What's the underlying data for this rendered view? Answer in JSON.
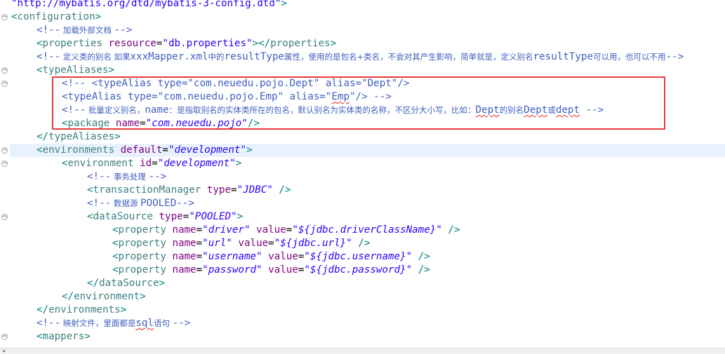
{
  "editor": {
    "lines": [
      {
        "gutter": "",
        "fold": "",
        "highlight": false,
        "indent": 0,
        "tokens": [
          [
            "val",
            "\"http://mybatis.org/dtd/mybatis-3-config.dtd\""
          ],
          [
            "punc",
            ">"
          ]
        ]
      },
      {
        "gutter": "",
        "fold": "collapse",
        "highlight": false,
        "indent": 0,
        "tokens": [
          [
            "punc",
            "<"
          ],
          [
            "tag",
            "configuration"
          ],
          [
            "punc",
            ">"
          ]
        ]
      },
      {
        "gutter": "",
        "fold": "",
        "highlight": false,
        "indent": 1,
        "tokens": [
          [
            "com",
            "<!--"
          ],
          [
            "comcjk",
            " 加载外部文档 "
          ],
          [
            "com",
            "-->"
          ]
        ]
      },
      {
        "gutter": "",
        "fold": "",
        "highlight": false,
        "indent": 1,
        "tokens": [
          [
            "punc",
            "<"
          ],
          [
            "tag",
            "properties"
          ],
          [
            "plain",
            " "
          ],
          [
            "attr",
            "resource"
          ],
          [
            "plain",
            "="
          ],
          [
            "val",
            "\"db.properties\""
          ],
          [
            "punc",
            "></"
          ],
          [
            "tag",
            "properties"
          ],
          [
            "punc",
            ">"
          ]
        ]
      },
      {
        "gutter": "",
        "fold": "",
        "highlight": false,
        "indent": 1,
        "tokens": [
          [
            "com",
            "<!--"
          ],
          [
            "comcjk",
            " 定义类的别名 如果"
          ],
          [
            "com",
            "xxxMapper.xml"
          ],
          [
            "comcjk",
            "中的"
          ],
          [
            "com",
            "resultType"
          ],
          [
            "comcjk",
            "属性，使用的是包名+类名，不会对其产生影响，简单就是，定义别名"
          ],
          [
            "com",
            "resultType"
          ],
          [
            "comcjk",
            "可以用，也可以不用"
          ],
          [
            "com",
            "-->"
          ]
        ]
      },
      {
        "gutter": "",
        "fold": "collapse",
        "highlight": false,
        "indent": 1,
        "tokens": [
          [
            "punc",
            "<"
          ],
          [
            "tag",
            "typeAliases"
          ],
          [
            "punc",
            ">"
          ]
        ]
      },
      {
        "gutter": "",
        "fold": "collapse",
        "highlight": false,
        "indent": 2,
        "tokens": [
          [
            "com",
            "<!-- <typeAlias type=\"com.neuedu.pojo.Dept\" alias=\"Dept\"/>"
          ]
        ]
      },
      {
        "gutter": "",
        "fold": "",
        "highlight": false,
        "indent": 2,
        "tokens": [
          [
            "com",
            "<typeAlias type=\"com.neuedu.pojo.Emp\" alias=\""
          ],
          [
            "comsq",
            "Emp"
          ],
          [
            "com",
            "\"/> -->"
          ]
        ]
      },
      {
        "gutter": "",
        "fold": "",
        "highlight": false,
        "indent": 2,
        "tokens": [
          [
            "com",
            "<!--"
          ],
          [
            "comcjk",
            " 批量定义别名，"
          ],
          [
            "com",
            "name"
          ],
          [
            "comcjk",
            "：是指取别名的实体类所在的包名，默认别名为实体类的名称，不区分大小写，比如："
          ],
          [
            "comsq",
            "Dept"
          ],
          [
            "comcjk",
            "的别名"
          ],
          [
            "comsq",
            "Dept"
          ],
          [
            "comcjk",
            "或"
          ],
          [
            "comsq",
            "dept"
          ],
          [
            "com",
            " -->"
          ]
        ]
      },
      {
        "gutter": "",
        "fold": "",
        "highlight": false,
        "indent": 2,
        "tokens": [
          [
            "punc",
            "<"
          ],
          [
            "tag",
            "package"
          ],
          [
            "plain",
            " "
          ],
          [
            "attr",
            "name"
          ],
          [
            "plain",
            "="
          ],
          [
            "ival",
            "\"com.neuedu.pojo\""
          ],
          [
            "punc",
            "/>"
          ]
        ]
      },
      {
        "gutter": "",
        "fold": "",
        "highlight": false,
        "indent": 1,
        "tokens": [
          [
            "punc",
            "</"
          ],
          [
            "tag",
            "typeAliases"
          ],
          [
            "punc",
            ">"
          ]
        ]
      },
      {
        "gutter": "",
        "fold": "collapse",
        "highlight": true,
        "indent": 1,
        "tokens": [
          [
            "punc",
            "<"
          ],
          [
            "tag",
            "environments"
          ],
          [
            "plain",
            " "
          ],
          [
            "attr",
            "default"
          ],
          [
            "plain",
            "="
          ],
          [
            "ival",
            "\"development\""
          ],
          [
            "punc",
            ">"
          ]
        ]
      },
      {
        "gutter": "",
        "fold": "collapse",
        "highlight": false,
        "indent": 2,
        "tokens": [
          [
            "punc",
            "<"
          ],
          [
            "tag",
            "environment"
          ],
          [
            "plain",
            " "
          ],
          [
            "attr",
            "id"
          ],
          [
            "plain",
            "="
          ],
          [
            "ival",
            "\"development\""
          ],
          [
            "punc",
            ">"
          ]
        ]
      },
      {
        "gutter": "",
        "fold": "",
        "highlight": false,
        "indent": 3,
        "tokens": [
          [
            "com",
            "<!--"
          ],
          [
            "comcjk",
            " 事务处理 "
          ],
          [
            "com",
            "-->"
          ]
        ]
      },
      {
        "gutter": "",
        "fold": "",
        "highlight": false,
        "indent": 3,
        "tokens": [
          [
            "punc",
            "<"
          ],
          [
            "tag",
            "transactionManager"
          ],
          [
            "plain",
            " "
          ],
          [
            "attr",
            "type"
          ],
          [
            "plain",
            "="
          ],
          [
            "ival",
            "\"JDBC\""
          ],
          [
            "plain",
            " "
          ],
          [
            "punc",
            "/>"
          ]
        ]
      },
      {
        "gutter": "",
        "fold": "",
        "highlight": false,
        "indent": 3,
        "tokens": [
          [
            "com",
            "<!--"
          ],
          [
            "comcjk",
            " 数据源 "
          ],
          [
            "com",
            "POOLED-->"
          ]
        ]
      },
      {
        "gutter": "",
        "fold": "collapse",
        "highlight": false,
        "indent": 3,
        "tokens": [
          [
            "punc",
            "<"
          ],
          [
            "tag",
            "dataSource"
          ],
          [
            "plain",
            " "
          ],
          [
            "attr",
            "type"
          ],
          [
            "plain",
            "="
          ],
          [
            "ival",
            "\"POOLED\""
          ],
          [
            "punc",
            ">"
          ]
        ]
      },
      {
        "gutter": "",
        "fold": "",
        "highlight": false,
        "indent": 4,
        "tokens": [
          [
            "punc",
            "<"
          ],
          [
            "tag",
            "property"
          ],
          [
            "plain",
            " "
          ],
          [
            "attr",
            "name"
          ],
          [
            "plain",
            "="
          ],
          [
            "ival",
            "\"driver\""
          ],
          [
            "plain",
            " "
          ],
          [
            "attr",
            "value"
          ],
          [
            "plain",
            "="
          ],
          [
            "ival",
            "\"${jdbc.driverClassName}\""
          ],
          [
            "plain",
            " "
          ],
          [
            "punc",
            "/>"
          ]
        ]
      },
      {
        "gutter": "",
        "fold": "",
        "highlight": false,
        "indent": 4,
        "tokens": [
          [
            "punc",
            "<"
          ],
          [
            "tag",
            "property"
          ],
          [
            "plain",
            " "
          ],
          [
            "attr",
            "name"
          ],
          [
            "plain",
            "="
          ],
          [
            "ival",
            "\"url\""
          ],
          [
            "plain",
            " "
          ],
          [
            "attr",
            "value"
          ],
          [
            "plain",
            "="
          ],
          [
            "ival",
            "\"${jdbc.url}\""
          ],
          [
            "plain",
            " "
          ],
          [
            "punc",
            "/>"
          ]
        ]
      },
      {
        "gutter": "",
        "fold": "",
        "highlight": false,
        "indent": 4,
        "tokens": [
          [
            "punc",
            "<"
          ],
          [
            "tag",
            "property"
          ],
          [
            "plain",
            " "
          ],
          [
            "attr",
            "name"
          ],
          [
            "plain",
            "="
          ],
          [
            "ival",
            "\"username\""
          ],
          [
            "plain",
            " "
          ],
          [
            "attr",
            "value"
          ],
          [
            "plain",
            "="
          ],
          [
            "ival",
            "\"${jdbc.username}\""
          ],
          [
            "plain",
            " "
          ],
          [
            "punc",
            "/>"
          ]
        ]
      },
      {
        "gutter": "",
        "fold": "",
        "highlight": false,
        "indent": 4,
        "tokens": [
          [
            "punc",
            "<"
          ],
          [
            "tag",
            "property"
          ],
          [
            "plain",
            " "
          ],
          [
            "attr",
            "name"
          ],
          [
            "plain",
            "="
          ],
          [
            "ival",
            "\"password\""
          ],
          [
            "plain",
            " "
          ],
          [
            "attr",
            "value"
          ],
          [
            "plain",
            "="
          ],
          [
            "ival",
            "\"${jdbc.password}\""
          ],
          [
            "plain",
            " "
          ],
          [
            "punc",
            "/>"
          ]
        ]
      },
      {
        "gutter": "",
        "fold": "",
        "highlight": false,
        "indent": 3,
        "tokens": [
          [
            "punc",
            "</"
          ],
          [
            "tag",
            "dataSource"
          ],
          [
            "punc",
            ">"
          ]
        ]
      },
      {
        "gutter": "",
        "fold": "",
        "highlight": false,
        "indent": 2,
        "tokens": [
          [
            "punc",
            "</"
          ],
          [
            "tag",
            "environment"
          ],
          [
            "punc",
            ">"
          ]
        ]
      },
      {
        "gutter": "",
        "fold": "",
        "highlight": false,
        "indent": 1,
        "tokens": [
          [
            "punc",
            "</"
          ],
          [
            "tag",
            "environments"
          ],
          [
            "punc",
            ">"
          ]
        ]
      },
      {
        "gutter": "",
        "fold": "",
        "highlight": false,
        "indent": 1,
        "tokens": [
          [
            "com",
            "<!--"
          ],
          [
            "comcjk",
            " 映射文件，里面都是"
          ],
          [
            "comsq",
            "sql"
          ],
          [
            "comcjk",
            "语句 "
          ],
          [
            "com",
            "-->"
          ]
        ]
      },
      {
        "gutter": "",
        "fold": "collapse",
        "highlight": false,
        "indent": 1,
        "tokens": [
          [
            "punc",
            "<"
          ],
          [
            "tag",
            "mappers"
          ],
          [
            "punc",
            ">"
          ]
        ]
      }
    ]
  },
  "highlight_box": {
    "color": "#e83a3a"
  },
  "scrollbar": {
    "left_arrow_icon": "scroll-left-arrow-icon"
  }
}
